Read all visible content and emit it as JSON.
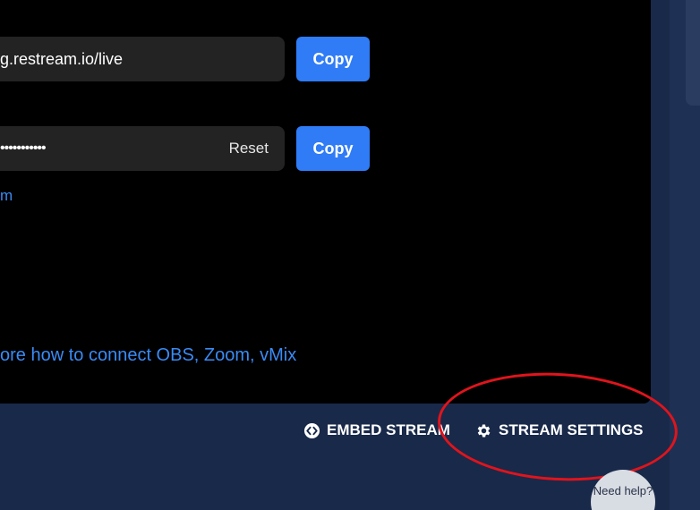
{
  "ingest": {
    "server_url_value": "g.restream.io/live",
    "stream_key_value": "•••••••••••",
    "reset_label": "Reset",
    "copy_label_1": "Copy",
    "copy_label_2": "Copy",
    "small_link_text": "m",
    "help_link_text": "ore how to connect OBS, Zoom, vMix"
  },
  "actions": {
    "embed_label": "EMBED STREAM",
    "settings_label": "STREAM SETTINGS"
  },
  "help_widget": {
    "label": "Need help?"
  },
  "colors": {
    "accent": "#2f7cf6",
    "link": "#3a8bf5",
    "background": "#19294a",
    "panel": "#000000",
    "annotation": "#e0141c"
  },
  "icons": {
    "embed": "embed-code-icon",
    "settings": "gear-icon"
  }
}
